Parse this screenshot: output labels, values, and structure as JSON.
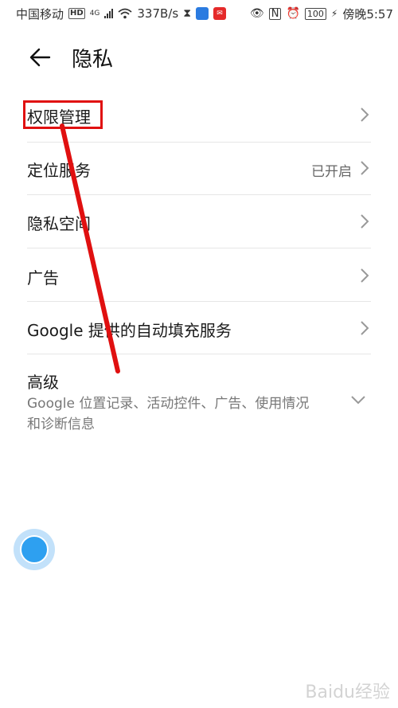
{
  "status_bar": {
    "carrier": "中国移动",
    "network_badge": "HD",
    "signal_gen": "4G",
    "speed": "337B/s",
    "battery": "100",
    "time": "傍晚5:57"
  },
  "header": {
    "title": "隐私",
    "back_icon": "arrow-left-icon"
  },
  "items": [
    {
      "label": "权限管理",
      "value": "",
      "icon": "chevron-right-icon"
    },
    {
      "label": "定位服务",
      "value": "已开启",
      "icon": "chevron-right-icon"
    },
    {
      "label": "隐私空间",
      "value": "",
      "icon": "chevron-right-icon"
    },
    {
      "label": "广告",
      "value": "",
      "icon": "chevron-right-icon"
    },
    {
      "label": "Google 提供的自动填充服务",
      "value": "",
      "icon": "chevron-right-icon"
    }
  ],
  "advanced": {
    "label": "高级",
    "subtitle": "Google 位置记录、活动控件、广告、使用情况和诊断信息",
    "icon": "chevron-down-icon"
  },
  "colors": {
    "annotation": "#e01010",
    "fab": "#2ea0f0"
  },
  "watermark": "Baidu经验"
}
